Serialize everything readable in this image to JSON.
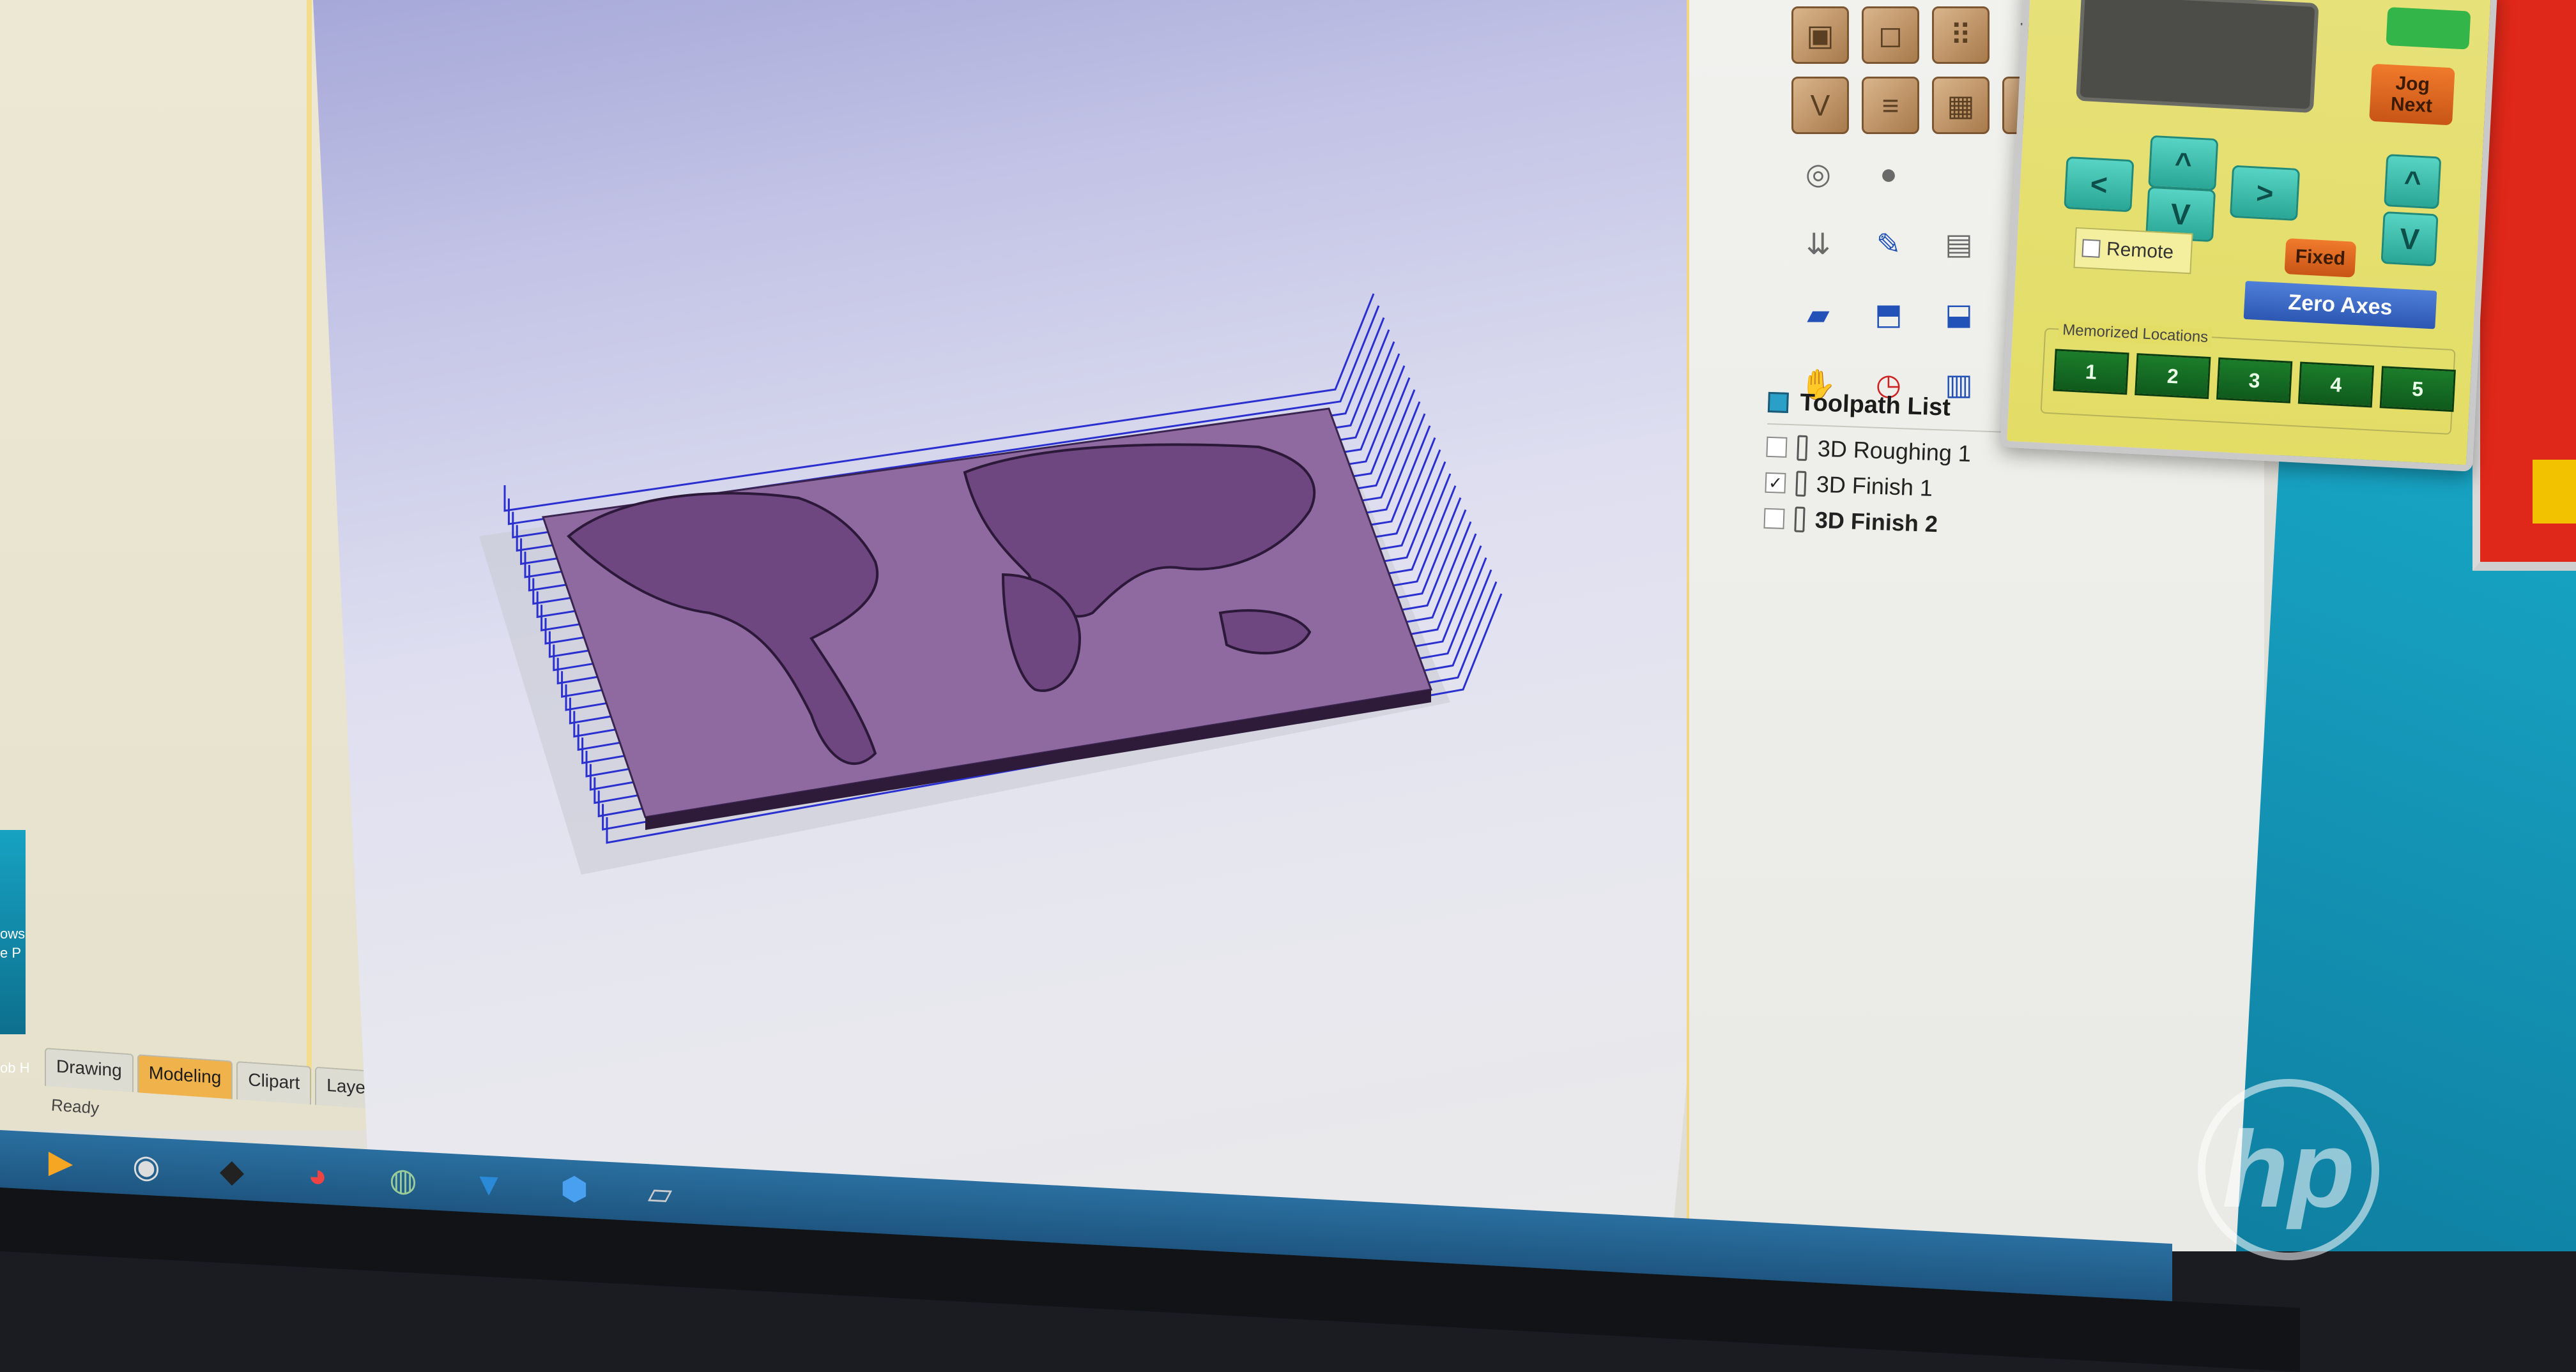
{
  "left_panel": {
    "tabs": [
      "Drawing",
      "Modeling",
      "Clipart",
      "Layers"
    ],
    "active_tab": "Modeling",
    "status": "Ready",
    "desktop_labels": [
      "ows",
      "e P",
      "ob H"
    ]
  },
  "toolbar": {
    "tools": [
      "box-select-icon",
      "square-icon",
      "dots-grid-icon",
      "text-icon",
      "v-carve-icon",
      "pattern-icon",
      "texture-icon",
      "prism-icon",
      "fluting-icon",
      "sphere-icon",
      "drill-icon",
      "edit-toolpath-icon",
      "preview-icon",
      "delete-icon",
      "open-toolpath-icon",
      "save-toolpath-icon",
      "import-icon",
      "merge-icon",
      "hand-icon",
      "clock-icon",
      "tiling-icon",
      "save-icon"
    ]
  },
  "toolpath_list": {
    "title": "Toolpath List",
    "items": [
      {
        "label": "3D Roughing 1",
        "checked": false,
        "bold": false
      },
      {
        "label": "3D Finish 1",
        "checked": true,
        "bold": false
      },
      {
        "label": "3D Finish 2",
        "checked": false,
        "bold": true
      }
    ]
  },
  "pendant": {
    "jog_next": "Jog\nNext",
    "fixed": "Fixed",
    "remote": "Remote",
    "zero_axes": "Zero Axes",
    "memorized_label": "Memorized Locations",
    "memorized": [
      "1",
      "2",
      "3",
      "4",
      "5"
    ],
    "arrows": {
      "left": "<",
      "up": "^",
      "down": "V",
      "right": ">",
      "z_up": "^",
      "z_down": "V"
    }
  },
  "desktop": {
    "brand": "hp"
  },
  "colors": {
    "accent_yellow": "#e3dd66",
    "teal": "#2aa696",
    "orange": "#e0651f",
    "model_purple": "#8a5c98",
    "toolpath_blue": "#2a2fd0"
  }
}
